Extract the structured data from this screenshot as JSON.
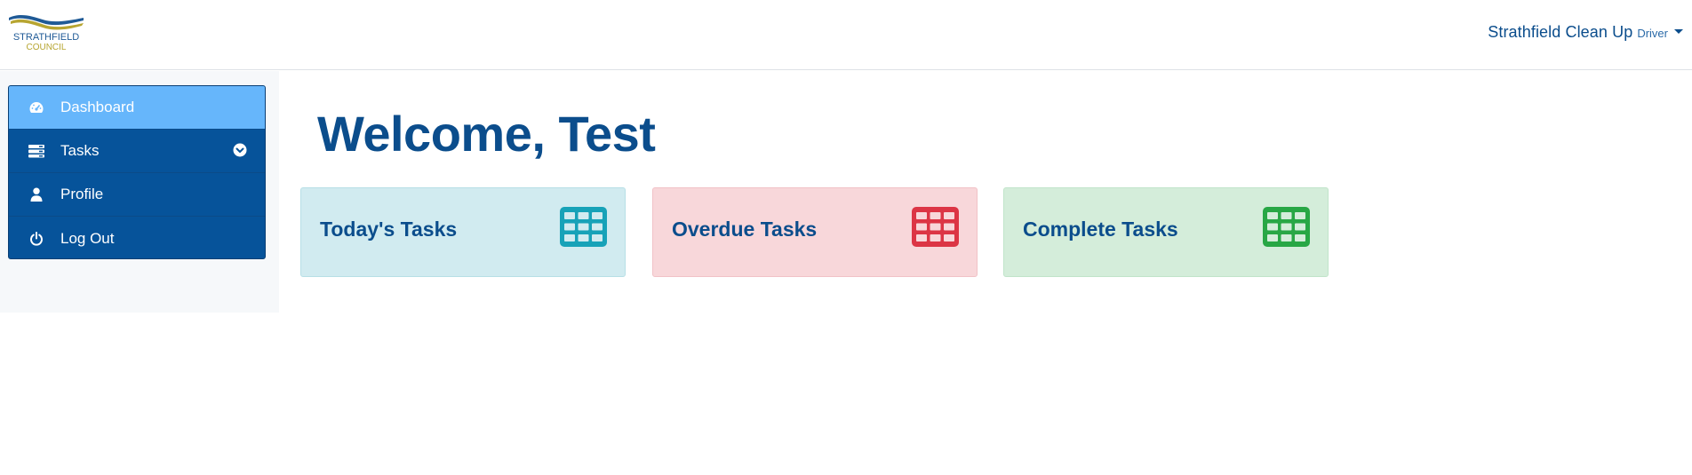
{
  "header": {
    "logo": {
      "line1": "STRATHFIELD",
      "line2": "COUNCIL"
    },
    "user": {
      "name": "Strathfield Clean Up",
      "role": "Driver"
    }
  },
  "sidebar": {
    "items": [
      {
        "label": "Dashboard",
        "icon": "dashboard-icon",
        "active": true
      },
      {
        "label": "Tasks",
        "icon": "tasks-icon",
        "has_submenu": true
      },
      {
        "label": "Profile",
        "icon": "user-icon"
      },
      {
        "label": "Log Out",
        "icon": "power-icon"
      }
    ]
  },
  "main": {
    "title": "Welcome, Test",
    "cards": [
      {
        "title": "Today's Tasks",
        "icon": "table-icon",
        "color": "#17a2b8"
      },
      {
        "title": "Overdue Tasks",
        "icon": "table-icon",
        "color": "#dc3545"
      },
      {
        "title": "Complete Tasks",
        "icon": "table-icon",
        "color": "#28a745"
      }
    ]
  },
  "colors": {
    "primary": "#0b4d8c",
    "sidebar_bg": "#06539a",
    "sidebar_active": "#66b6fb"
  }
}
